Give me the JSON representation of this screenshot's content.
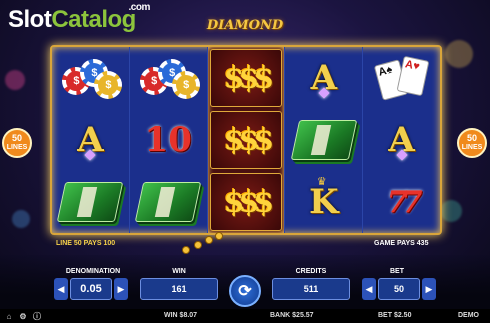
{
  "watermark": {
    "part1": "Slot",
    "part2": "Catalog",
    "suffix": ".com"
  },
  "game_logo": "DIAMOND",
  "lines_badge": {
    "number": "50",
    "label": "LINES"
  },
  "reels": [
    [
      "chips",
      "A",
      "cash"
    ],
    [
      "chips",
      "10",
      "cash"
    ],
    [
      "dollar",
      "dollar",
      "dollar"
    ],
    [
      "A",
      "cash",
      "K"
    ],
    [
      "cards",
      "A",
      "seven"
    ]
  ],
  "symbols": {
    "A": "A",
    "K": "K",
    "10": "10",
    "dollar": "$$$",
    "seven": "77",
    "chip_value": "$",
    "card_rank_1": "A",
    "card_rank_2": "A"
  },
  "win_message": "LINE 50 PAYS 100",
  "game_pays": "GAME PAYS 435",
  "panel": {
    "denomination": {
      "label": "DENOMINATION",
      "value": "0.05"
    },
    "win": {
      "label": "WIN",
      "value": "161",
      "sub": "WIN $8.07"
    },
    "credits": {
      "label": "CREDITS",
      "value": "511",
      "sub": "BANK $25.57"
    },
    "bet": {
      "label": "BET",
      "value": "50",
      "sub": "BET $2.50"
    }
  },
  "footer": {
    "mode": "DEMO"
  },
  "icons": [
    "spin-icon",
    "settings-icon",
    "info-icon",
    "chevron-left-icon",
    "chevron-right-icon",
    "home-icon"
  ]
}
